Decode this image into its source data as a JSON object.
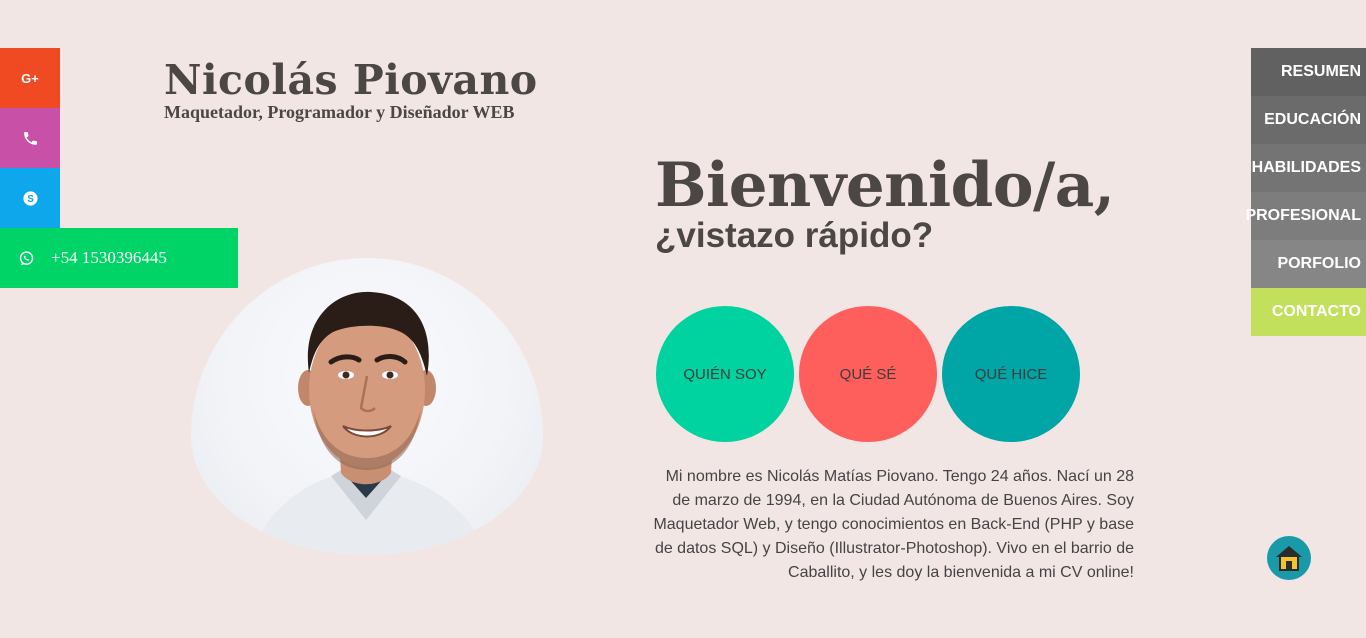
{
  "header": {
    "name": "Nicolás Piovano",
    "subtitle": "Maquetador, Programador y Diseñador WEB"
  },
  "social": {
    "google_label": "G+",
    "whatsapp_number": "+54 1530396445"
  },
  "hero": {
    "welcome": "Bienvenido/a,",
    "quick": "¿vistazo rápido?",
    "bio": "Mi nombre es Nicolás Matías Piovano. Tengo 24 años. Nací un 28 de marzo de 1994, en la Ciudad Autónoma de Buenos Aires. Soy Maquetador Web, y tengo conocimientos en Back-End (PHP y base de datos SQL) y Diseño (Illustrator-Photoshop). Vivo en el barrio de Caballito, y les doy la bienvenida a mi CV online!"
  },
  "circles": [
    {
      "label": "QUIÉN SOY",
      "color": "#00d39f"
    },
    {
      "label": "QUÉ SÉ",
      "color": "#fe5e5c"
    },
    {
      "label": "QUÉ HICE",
      "color": "#00a5a6"
    }
  ],
  "nav": {
    "items": [
      {
        "label": "RESUMEN"
      },
      {
        "label": "EDUCACIÓN"
      },
      {
        "label": "HABILIDADES"
      },
      {
        "label": "PROFESIONAL"
      },
      {
        "label": "PORFOLIO"
      },
      {
        "label": "CONTACTO",
        "active": true
      }
    ]
  },
  "icons": {
    "google": "google-plus-icon",
    "phone": "phone-icon",
    "skype": "skype-icon",
    "whatsapp": "whatsapp-icon",
    "home": "home-icon"
  },
  "colors": {
    "background": "#f2e6e4",
    "google": "#f04a22",
    "phone": "#c850a6",
    "skype": "#0fa7ec",
    "whatsapp": "#00d467",
    "nav_active": "#c3e05c",
    "home": "#1a9aa8"
  }
}
